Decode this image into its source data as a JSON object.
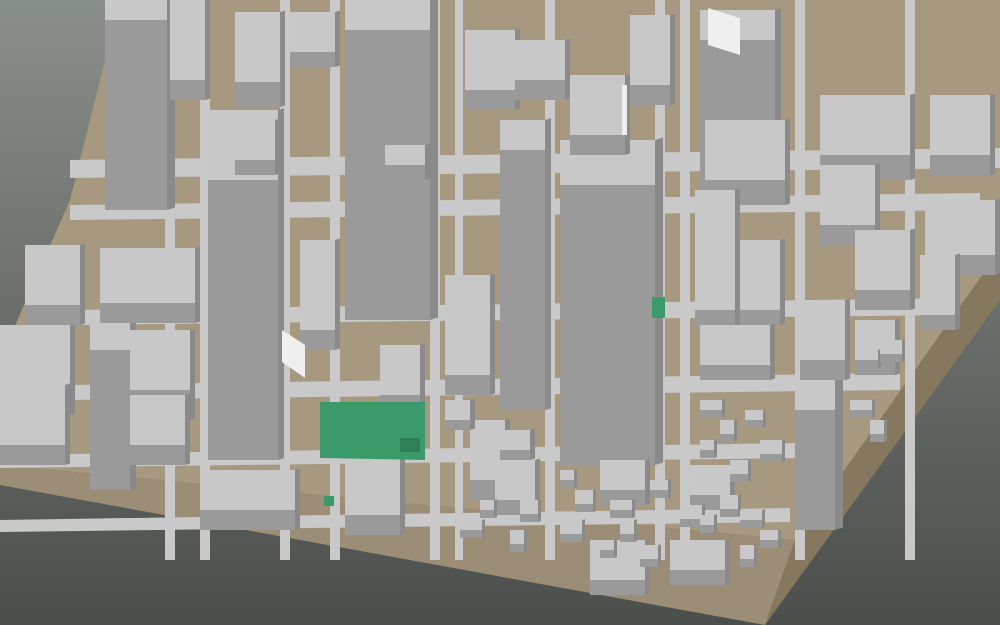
{
  "scene": {
    "kind": "3d-city-block-model",
    "colors": {
      "background_top": "#8a8f8a",
      "background_bottom": "#4b4f4c",
      "ground": "#a79880",
      "base_side": "#9c8d76",
      "base_side_right": "#86785f",
      "road": "#c9c9c9",
      "building_top": "#c8c8c8",
      "building_face": "#9a9a9a",
      "building_face_dark": "#8a8a8a",
      "park": "#3a9a6a",
      "park_dark": "#2f7f57",
      "glass_highlight": "#efefef"
    }
  }
}
